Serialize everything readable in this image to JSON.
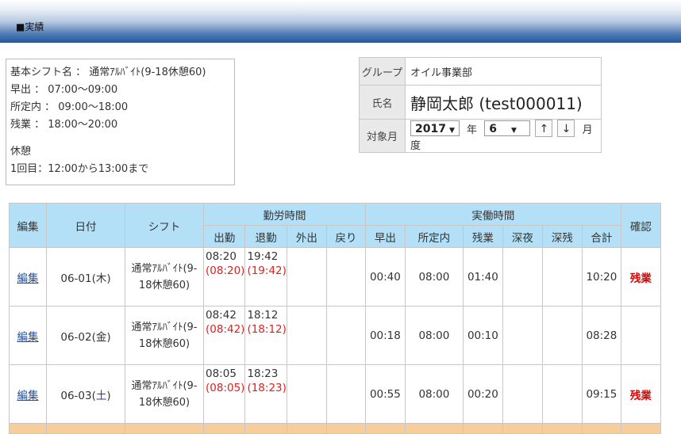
{
  "header": {
    "title": "■実績"
  },
  "shift_info": {
    "lines": [
      "基本シフト名 ： 通常ｱﾙﾊﾞｲﾄ(9-18休憩60)",
      "早出 ： 07:00～09:00",
      "所定内 ： 09:00～18:00",
      "残業 ： 18:00～20:00"
    ],
    "break_title": "休憩",
    "break_line": "1回目：12:00から13:00まで"
  },
  "info": {
    "group_label": "グループ",
    "group_value": "オイル事業部",
    "name_label": "氏名",
    "name_value": "静岡太郎 (test000011)",
    "month_label": "対象月",
    "year_value": "2017",
    "year_unit": "年",
    "month_value": "6",
    "month_unit": "月度",
    "up_label": "↑",
    "down_label": "↓"
  },
  "table": {
    "headers": {
      "edit": "編集",
      "date": "日付",
      "shift": "シフト",
      "work_time": "勤労時間",
      "actual_time": "実働時間",
      "confirm": "確認",
      "clock_in": "出勤",
      "clock_out": "退勤",
      "go_out": "外出",
      "return": "戻り",
      "early": "早出",
      "regular": "所定内",
      "overtime": "残業",
      "late_night": "深夜",
      "late_overtime": "深残",
      "total": "合計"
    },
    "rows": [
      {
        "edit": "編集",
        "date": "06-01(木)",
        "shift": "通常ｱﾙﾊﾞｲﾄ(9-18休憩60)",
        "clock_in": "08:20",
        "clock_in_adj": "(08:20)",
        "clock_out": "19:42",
        "clock_out_adj": "(19:42)",
        "early": "00:40",
        "regular": "08:00",
        "overtime": "01:40",
        "total": "10:20",
        "confirm": "残業"
      },
      {
        "edit": "編集",
        "date": "06-02(金)",
        "shift": "通常ｱﾙﾊﾞｲﾄ(9-18休憩60)",
        "clock_in": "08:42",
        "clock_in_adj": "(08:42)",
        "clock_out": "18:12",
        "clock_out_adj": "(18:12)",
        "early": "00:18",
        "regular": "08:00",
        "overtime": "00:10",
        "total": "08:28",
        "confirm": ""
      },
      {
        "edit": "編集",
        "date_prefix": "06-03(",
        "date_day": "土",
        "date_suffix": ")",
        "shift": "通常ｱﾙﾊﾞｲﾄ(9-18休憩60)",
        "clock_in": "08:05",
        "clock_in_adj": "(08:05)",
        "clock_out": "18:23",
        "clock_out_adj": "(18:23)",
        "early": "00:55",
        "regular": "08:00",
        "overtime": "00:20",
        "total": "09:15",
        "confirm": "残業"
      }
    ]
  }
}
